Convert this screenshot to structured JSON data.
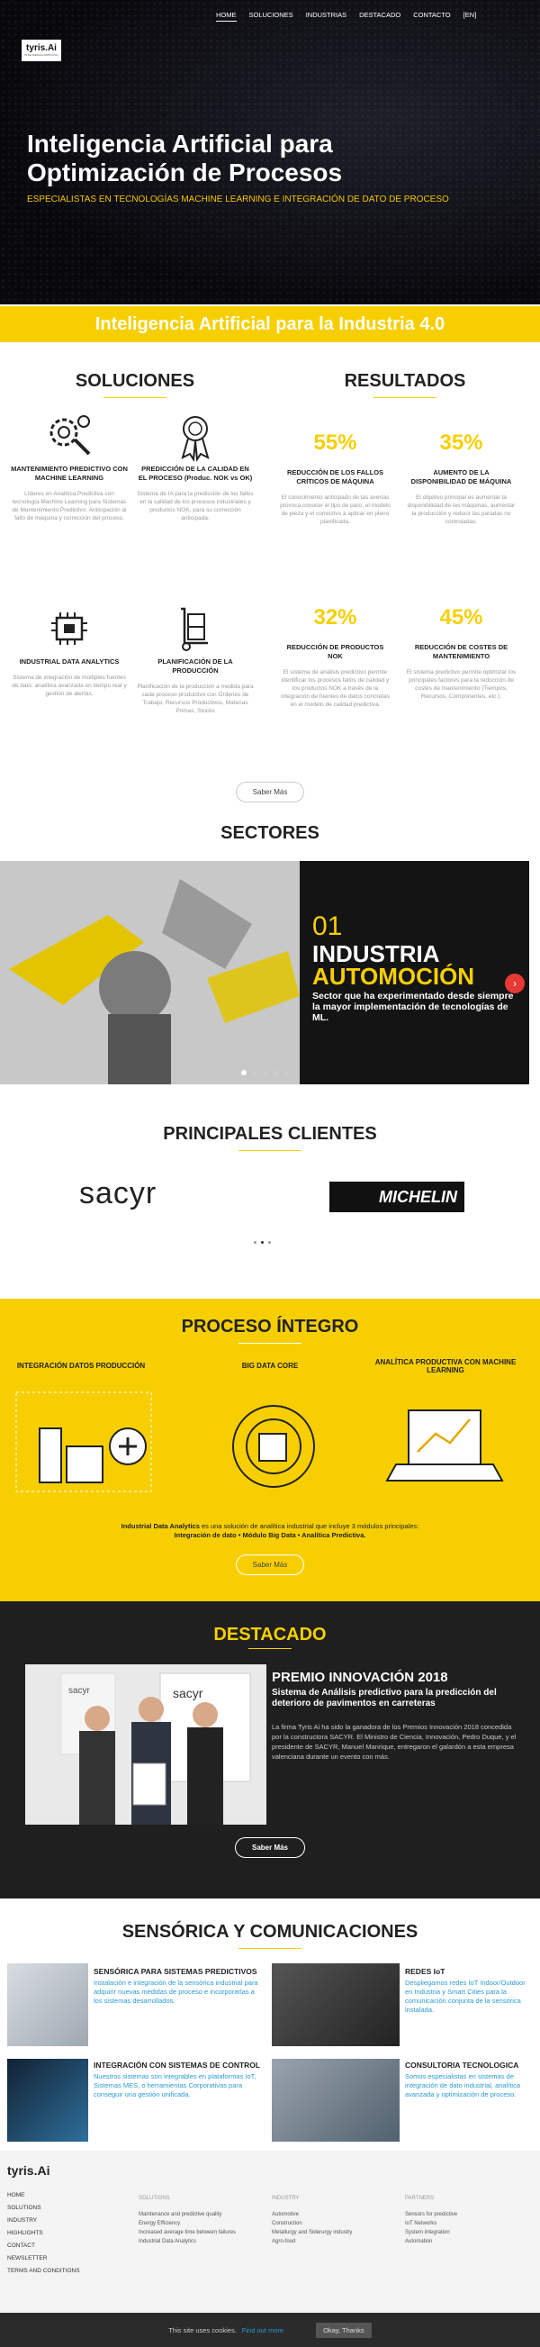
{
  "nav": {
    "logo": "tyris.Ai",
    "logo_sub": "INTELIGENCIA ARTIFICIAL",
    "items": [
      "HOME",
      "SOLUCIONES",
      "INDUSTRIAS",
      "DESTACADO",
      "CONTACTO",
      "[EN]"
    ]
  },
  "hero": {
    "title": "Inteligencia Artificial para Optimización de Procesos",
    "subtitle": "ESPECIALISTAS EN TECNOLOGÍAS MACHINE LEARNING E INTEGRACIÓN DE DATO DE PROCESO"
  },
  "band": "Inteligencia Artificial para la Industria 4.0",
  "soluciones": {
    "title": "SOLUCIONES",
    "items": [
      {
        "title": "MANTENIMIENTO PREDICTIVO CON MACHINE LEARNING",
        "desc": "Líderes en Analítica Predictiva con tecnología Machine Learning para Sistemas de Mantenimiento Predictivo. Anticipación al fallo de máquina y corrección del proceso.",
        "icon": "gear-brain-icon"
      },
      {
        "title": "PREDICCIÓN DE LA CALIDAD EN EL PROCESO (Produc. NOK vs OK)",
        "desc": "Sistema de IA para la predicción de los fallos en la calidad de los procesos industriales y productos NOK, para su corrección anticipada.",
        "icon": "quality-medal-icon"
      },
      {
        "title": "INDUSTRIAL DATA ANALYTICS",
        "desc": "Sistema de integración de múltiples fuentes de dato, analítica avanzada en tiempo real y gestión de alertas.",
        "icon": "chip-icon"
      },
      {
        "title": "PLANIFICACIÓN DE LA PRODUCCIÓN",
        "desc": "Planificación de la producción a medida para cada proceso productivo con Órdenes de Trabajo, Recursos Productivos, Materias Primas, Stocks",
        "icon": "hand-truck-icon"
      }
    ]
  },
  "resultados": {
    "title": "RESULTADOS",
    "items": [
      {
        "value": "55%",
        "title": "REDUCCIÓN DE LOS FALLOS CRÍTICOS DE MÁQUINA",
        "desc": "El conocimiento anticipado de las averías provoca conocer el tipo de paro, el modelo de pieza y el correctivo a aplicar en pleno planificada."
      },
      {
        "value": "35%",
        "title": "AUMENTO DE LA DISPONIBILIDAD DE MÁQUINA",
        "desc": "El objetivo principal es aumentar la disponibilidad de las máquinas, aumentar la producción y reducir las paradas no controladas."
      },
      {
        "value": "32%",
        "title": "REDUCCIÓN DE PRODUCTOS NOK",
        "desc": "El sistema de análisis predictivo permite identificar los procesos fallos de calidad y los productos NOK a través de la integración de fuentes de datos concretas en el modelo de calidad predictiva."
      },
      {
        "value": "45%",
        "title": "REDUCCIÓN DE COSTES DE MANTENIMIENTO",
        "desc": "El sistema predictivo permite optimizar los principales factores para la reducción de costes de mantenimiento (Tiempos, Recursos, Componentes, etc.)."
      }
    ]
  },
  "saber_mas": "Saber Más",
  "sectores": {
    "title": "SECTORES",
    "num": "01",
    "line1": "INDUSTRIA",
    "line2": "AUTOMOCIÓN",
    "desc": "Sector que ha experimentado desde siempre la mayor implementación de tecnologías de ML."
  },
  "clientes": {
    "title": "PRINCIPALES CLIENTES",
    "logos": [
      "sacyr",
      "MICHELIN"
    ]
  },
  "proceso": {
    "title": "PROCESO ÍNTEGRO",
    "cols": [
      "INTEGRACIÓN DATOS PRODUCCIÓN",
      "BIG DATA CORE",
      "ANALÍTICA PRODUCTIVA CON MACHINE LEARNING"
    ],
    "text1": "Industrial Data Analytics",
    "text2": " es una solución de analítica industrial que incluye 3 módulos principales:",
    "text3": "Integración de dato • Módulo Big Data • Analítica Predictiva."
  },
  "destacado": {
    "title": "DESTACADO",
    "award": "PREMIO INNOVACIÓN 2018",
    "sub": "Sistema de Análisis predictivo para la predicción del deterioro de pavimentos en carreteras",
    "body": "La firma Tyris Ai ha sido la ganadora de los Premios Innovación 2018 concedida por la constructora SACYR. El Ministro de Ciencia, Innovación, Pedro Duque, y el presidente de SACYR, Manuel Manrique, entregaron el galardón a esta empresa valenciana durante un evento con más.",
    "btn": "Saber Más",
    "photo_logos": [
      "sacyr",
      "sacyr"
    ]
  },
  "sensorica": {
    "title": "SENSÓRICA Y COMUNICACIONES",
    "items": [
      {
        "title": "SENSÓRICA PARA SISTEMAS PREDICTIVOS",
        "desc": "Instalación e integración de la sensórica industrial para adquirir nuevas medidas de proceso e incorporarlas a los sistemas desarrollados."
      },
      {
        "title": "REDES IoT",
        "desc": "Despliegamos redes IoT Indoor/Outdoor en Industria y Smart Cities para la comunicación conjunta de la sensórica instalada."
      },
      {
        "title": "INTEGRACIÓN CON SISTEMAS DE CONTROL",
        "desc": "Nuestros sistemas son integrables en plataformas IoT, Sistemas MES, o herramientas Corporativas para conseguir una gestión unificada."
      },
      {
        "title": "CONSULTORIA TECNOLOGICA",
        "desc": "Somos especialistas en sistemas de integración de dato industrial, analítica avanzada y optimización de proceso."
      }
    ]
  },
  "footer": {
    "logo": "tyris.Ai",
    "links": [
      "HOME",
      "SOLUTIONS",
      "INDUSTRY",
      "HIGHLIGHTS",
      "CONTACT",
      "NEWSLETTER",
      "TERMS AND CONDITIONS"
    ],
    "cols": [
      {
        "h": "SOLUTIONS",
        "items": [
          "Maintenance and predictive quality",
          "Energy Efficiency",
          "Increased average time between failures",
          "Industrial Data Analytics"
        ]
      },
      {
        "h": "INDUSTRY",
        "items": [
          "Automotive",
          "Construction",
          "Metallurgy and Siderurgy industry",
          "Agro-food"
        ]
      },
      {
        "h": "PARTNERS",
        "items": [
          "Sensors for predictive",
          "IoT Networks",
          "System integration",
          "Automation"
        ]
      }
    ]
  },
  "cookie": {
    "text": "This site uses cookies.",
    "link": "Find out more",
    "btn": "Okay, Thanks"
  },
  "colors": {
    "accent": "#f7cf00",
    "dark": "#1f1f1f"
  }
}
